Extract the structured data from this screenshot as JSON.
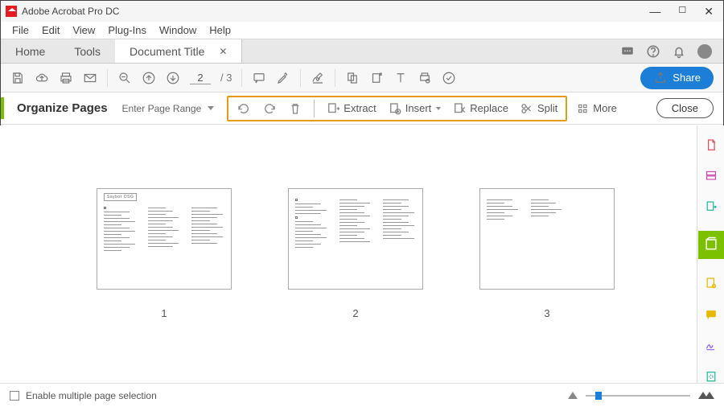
{
  "window": {
    "title": "Adobe Acrobat Pro DC"
  },
  "menu": [
    "File",
    "Edit",
    "View",
    "Plug-Ins",
    "Window",
    "Help"
  ],
  "tabs": {
    "home": "Home",
    "tools": "Tools",
    "doc": "Document Title"
  },
  "quickbar": {
    "page_current": "2",
    "page_total": "/ 3",
    "share": "Share"
  },
  "orgbar": {
    "title": "Organize Pages",
    "range": "Enter Page Range",
    "extract": "Extract",
    "insert": "Insert",
    "replace": "Replace",
    "split": "Split",
    "more": "More",
    "close": "Close"
  },
  "thumbs": {
    "p1": "1",
    "p2": "2",
    "p3": "3",
    "box_label": "Saybor OSG"
  },
  "footer": {
    "checkbox": "Enable multiple page selection"
  }
}
